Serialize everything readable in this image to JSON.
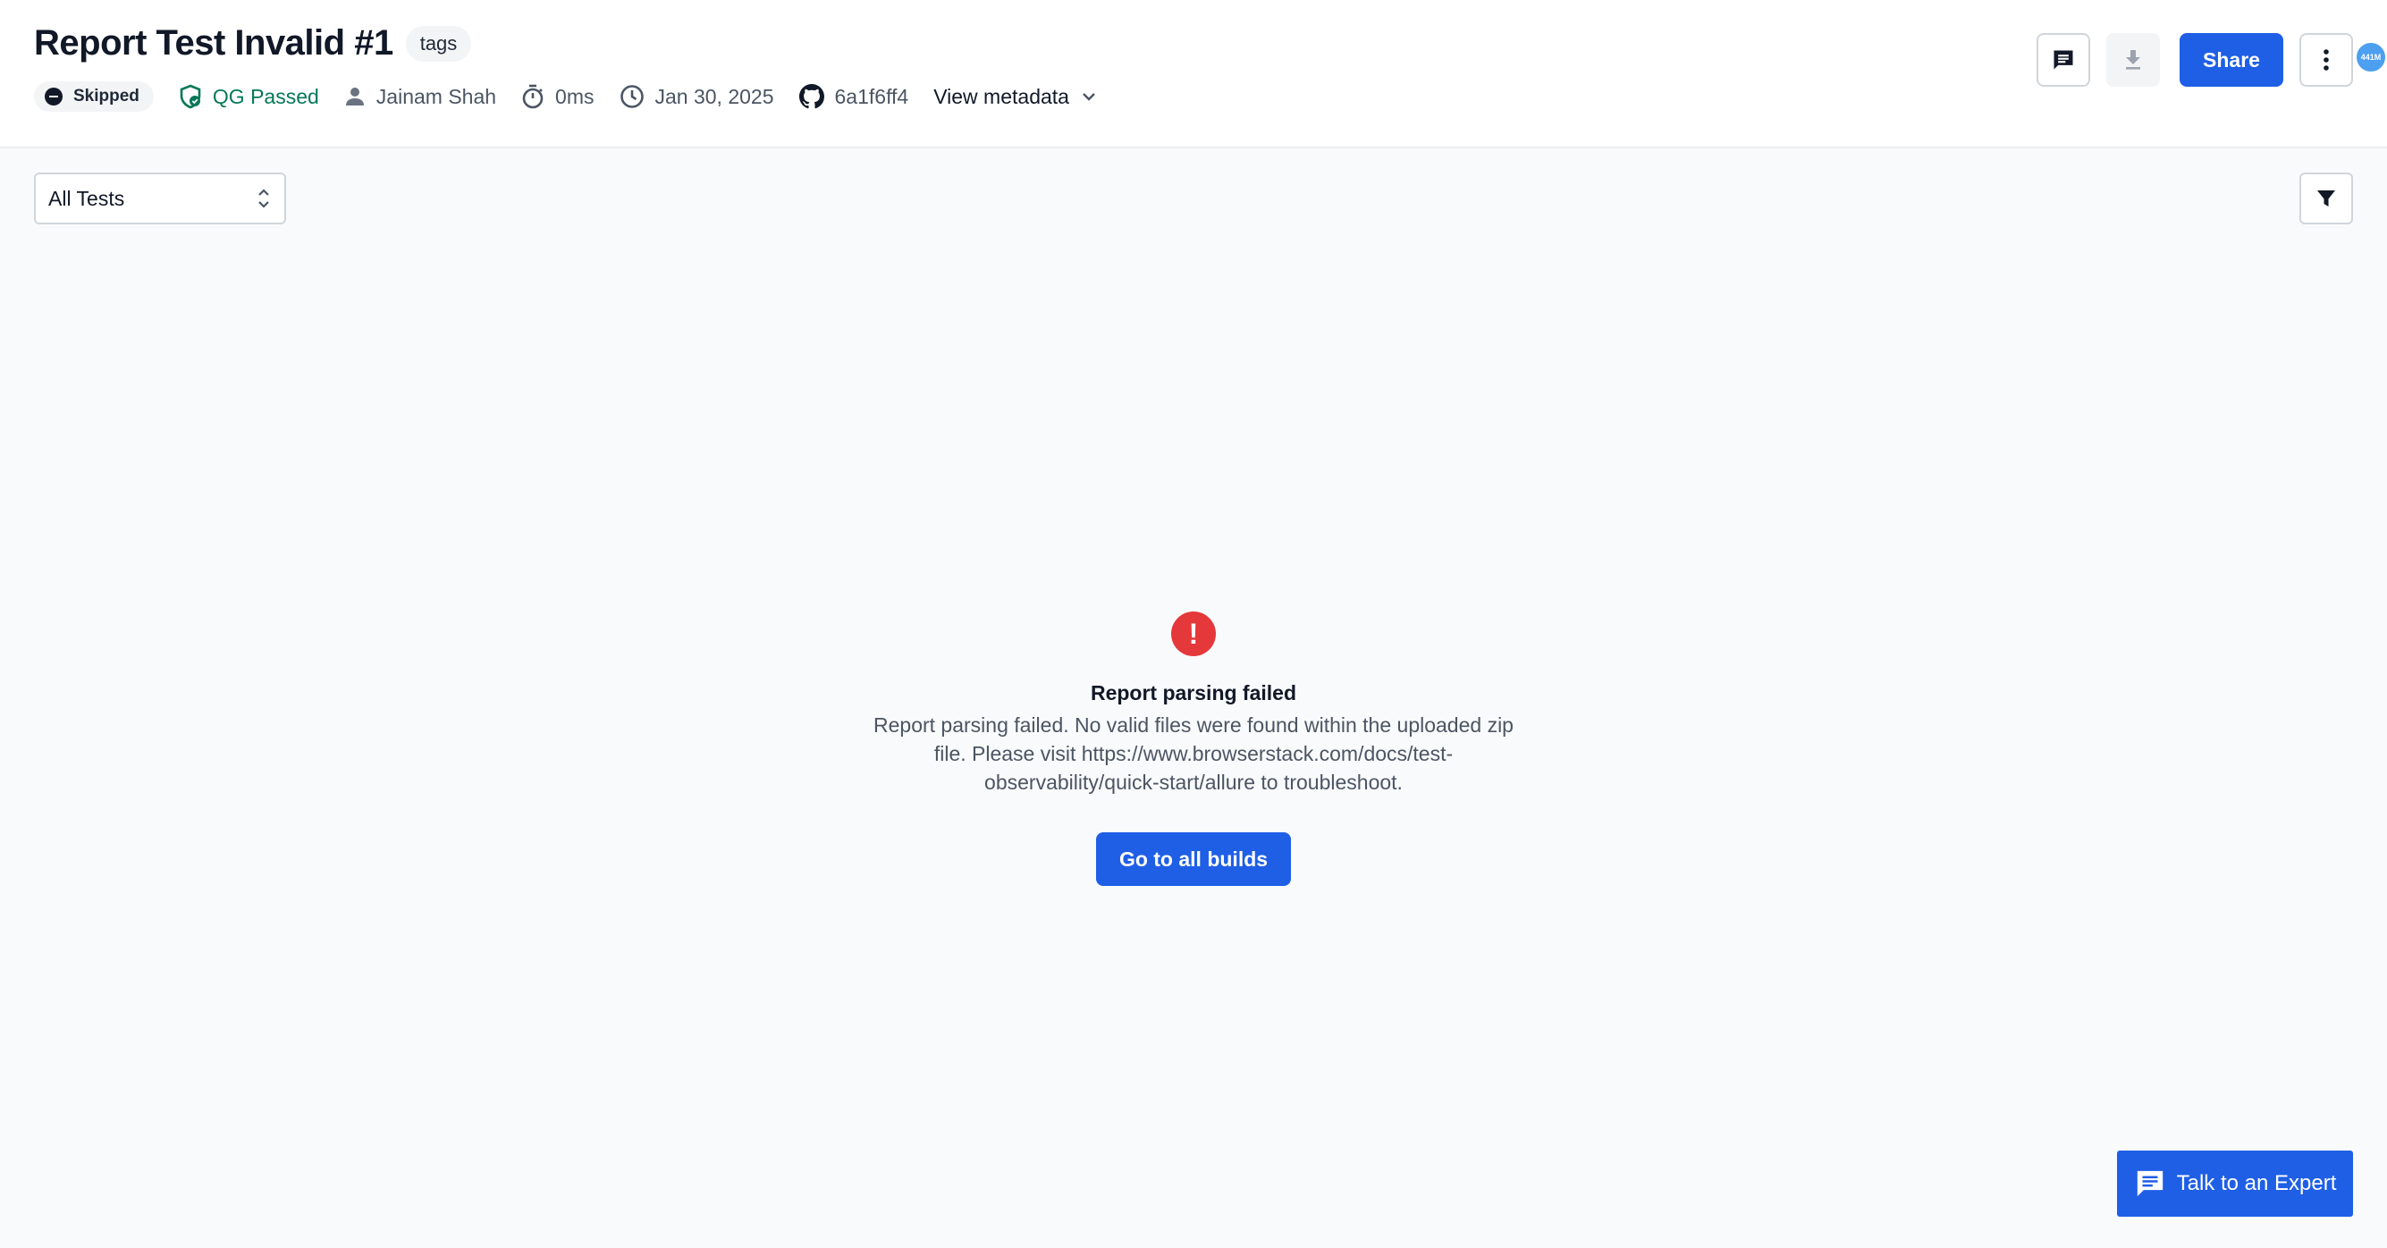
{
  "header": {
    "title": "Report Test Invalid #1",
    "tag": "tags",
    "status": "Skipped",
    "quality_gate": "QG Passed",
    "user": "Jainam Shah",
    "duration": "0ms",
    "date": "Jan 30, 2025",
    "commit": "6a1f6ff4",
    "view_metadata": "View metadata",
    "share_label": "Share",
    "avatar_initials": "441M"
  },
  "toolbar": {
    "test_filter_value": "All Tests"
  },
  "empty_state": {
    "title": "Report parsing failed",
    "message": "Report parsing failed. No valid files were found within the uploaded zip file. Please visit https://www.browserstack.com/docs/test-observability/quick-start/allure to troubleshoot.",
    "button": "Go to all builds"
  },
  "support": {
    "label": "Talk to an Expert"
  },
  "colors": {
    "primary": "#1f5fe6",
    "error": "#e5383b",
    "success": "#047857"
  }
}
